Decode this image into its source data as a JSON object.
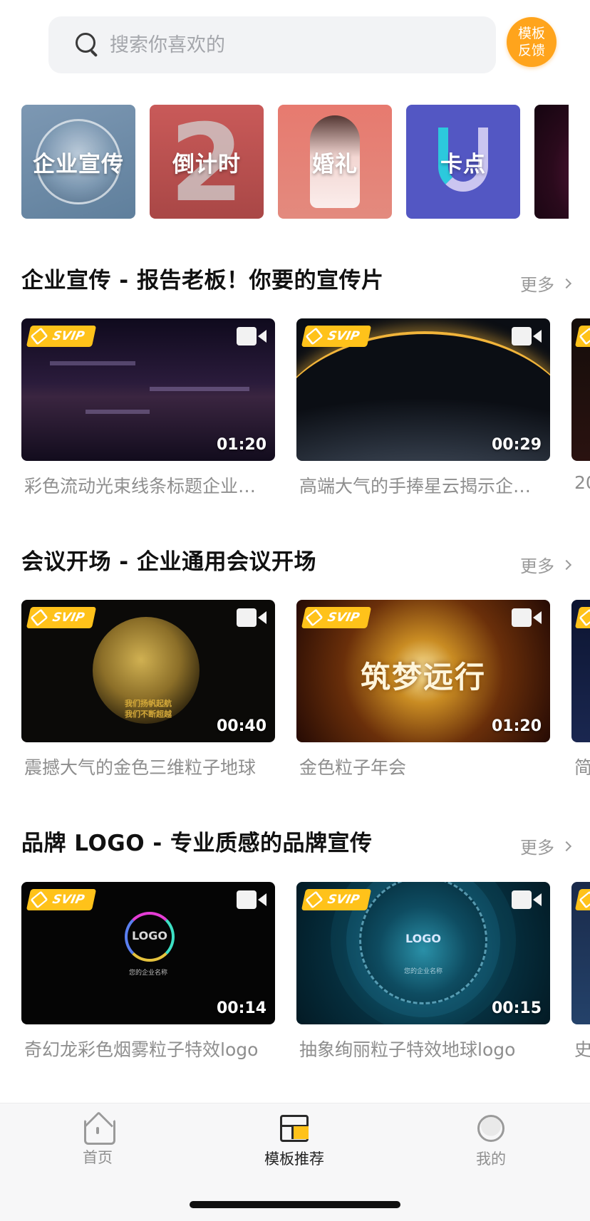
{
  "search": {
    "placeholder": "搜索你喜欢的"
  },
  "feedback": {
    "line1": "模板",
    "line2": "反馈"
  },
  "categories": [
    {
      "label": "企业宣传"
    },
    {
      "label": "倒计时"
    },
    {
      "label": "婚礼"
    },
    {
      "label": "卡点"
    },
    {
      "label": ""
    }
  ],
  "sections": [
    {
      "title": "企业宣传 - 报告老板！你要的宣传片",
      "more": "更多",
      "cards": [
        {
          "badge": "SVIP",
          "duration": "01:20",
          "title": "彩色流动光束线条标题企业宣传片"
        },
        {
          "badge": "SVIP",
          "duration": "00:29",
          "title": "高端大气的手捧星云揭示企业宣传"
        }
      ],
      "peek_title": "20"
    },
    {
      "title": "会议开场 - 企业通用会议开场",
      "more": "更多",
      "cards": [
        {
          "badge": "SVIP",
          "duration": "00:40",
          "title": "震撼大气的金色三维粒子地球",
          "overlay_line1": "我们扬帆起航",
          "overlay_line2": "我们不断超越"
        },
        {
          "badge": "SVIP",
          "duration": "01:20",
          "title": "金色粒子年会",
          "overlay_text": "筑梦远行"
        }
      ],
      "peek_title": "简"
    },
    {
      "title": "品牌 LOGO - 专业质感的品牌宣传",
      "more": "更多",
      "cards": [
        {
          "badge": "SVIP",
          "duration": "00:14",
          "title": "奇幻龙彩色烟雾粒子特效logo",
          "overlay_logo": "LOGO",
          "overlay_sub": "您的企业名称"
        },
        {
          "badge": "SVIP",
          "duration": "00:15",
          "title": "抽象绚丽粒子特效地球logo",
          "overlay_logo": "LOGO",
          "overlay_sub": "您的企业名称"
        }
      ],
      "peek_title": "史"
    }
  ],
  "tabs": [
    {
      "label": "首页",
      "active": false,
      "icon": "home-icon"
    },
    {
      "label": "模板推荐",
      "active": true,
      "icon": "template-icon"
    },
    {
      "label": "我的",
      "active": false,
      "icon": "profile-icon"
    }
  ],
  "colors": {
    "accent": "#ffc21a",
    "feedback": "#ffa41c",
    "text_secondary": "#8e8e8e"
  }
}
